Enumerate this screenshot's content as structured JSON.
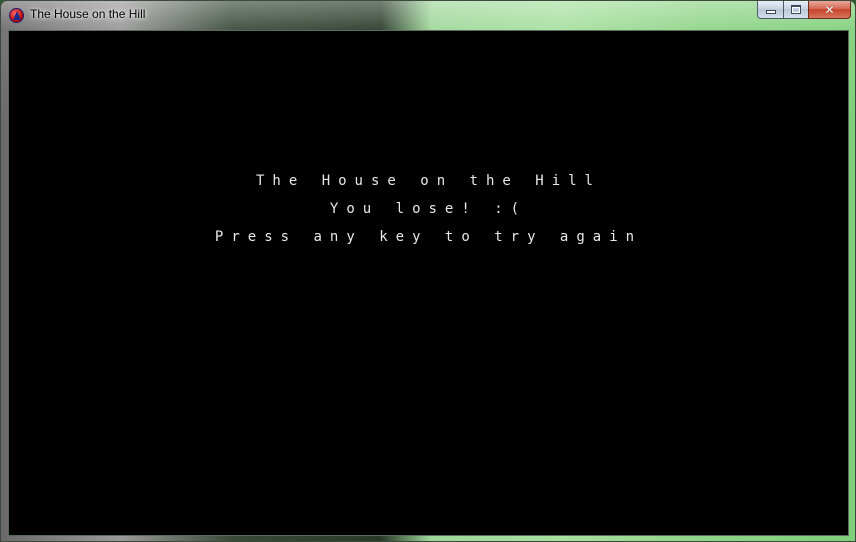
{
  "window": {
    "title": "The House on the Hill",
    "controls": {
      "minimize": "minimize",
      "maximize": "maximize",
      "close": "✕"
    }
  },
  "game": {
    "title_line": "The House on the Hill",
    "status_line": "You lose! :(",
    "prompt_line": "Press any key to try again",
    "background": "#000000",
    "text_color": "#e8e8e8"
  }
}
